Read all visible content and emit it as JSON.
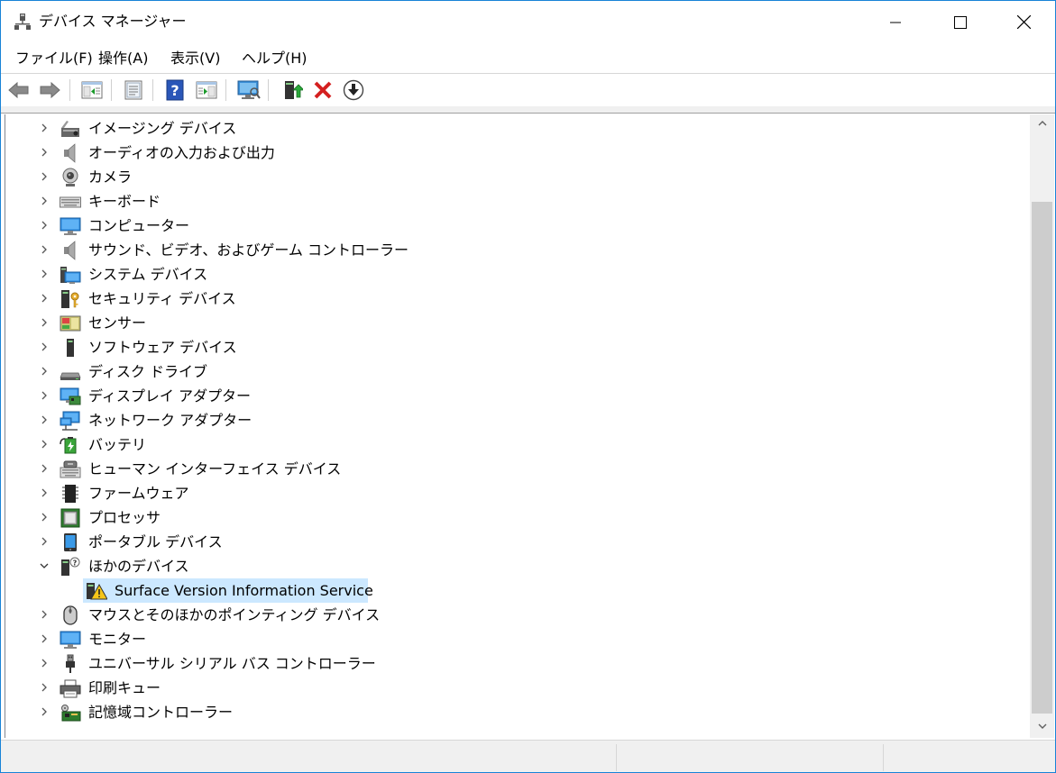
{
  "window": {
    "title": "デバイス マネージャー"
  },
  "menu": [
    {
      "label": "ファイル(F)"
    },
    {
      "label": "操作(A)"
    },
    {
      "label": "表示(V)"
    },
    {
      "label": "ヘルプ(H)"
    }
  ],
  "toolbar": {
    "buttons": [
      "back-arrow",
      "forward-arrow",
      "show-hide-console-tree",
      "properties",
      "help",
      "action-pane",
      "scan-hardware",
      "update-driver",
      "uninstall-device",
      "disable-device"
    ]
  },
  "tree": {
    "items": [
      {
        "label": "イメージング デバイス",
        "icon": "camera-scanner-icon",
        "expanded": false
      },
      {
        "label": "オーディオの入力および出力",
        "icon": "speaker-icon",
        "expanded": false
      },
      {
        "label": "カメラ",
        "icon": "webcam-icon",
        "expanded": false
      },
      {
        "label": "キーボード",
        "icon": "keyboard-icon",
        "expanded": false
      },
      {
        "label": "コンピューター",
        "icon": "monitor-icon",
        "expanded": false
      },
      {
        "label": "サウンド、ビデオ、およびゲーム コントローラー",
        "icon": "speaker-icon",
        "expanded": false
      },
      {
        "label": "システム デバイス",
        "icon": "system-devices-icon",
        "expanded": false
      },
      {
        "label": "セキュリティ デバイス",
        "icon": "security-key-icon",
        "expanded": false
      },
      {
        "label": "センサー",
        "icon": "sensor-icon",
        "expanded": false
      },
      {
        "label": "ソフトウェア デバイス",
        "icon": "software-device-icon",
        "expanded": false
      },
      {
        "label": "ディスク ドライブ",
        "icon": "disk-drive-icon",
        "expanded": false
      },
      {
        "label": "ディスプレイ アダプター",
        "icon": "display-adapter-icon",
        "expanded": false
      },
      {
        "label": "ネットワーク アダプター",
        "icon": "network-adapter-icon",
        "expanded": false
      },
      {
        "label": "バッテリ",
        "icon": "battery-icon",
        "expanded": false
      },
      {
        "label": "ヒューマン インターフェイス デバイス",
        "icon": "hid-icon",
        "expanded": false
      },
      {
        "label": "ファームウェア",
        "icon": "firmware-icon",
        "expanded": false
      },
      {
        "label": "プロセッサ",
        "icon": "processor-icon",
        "expanded": false
      },
      {
        "label": "ポータブル デバイス",
        "icon": "portable-device-icon",
        "expanded": false
      },
      {
        "label": "ほかのデバイス",
        "icon": "unknown-device-icon",
        "expanded": true
      },
      {
        "label": "Surface Version Information Service",
        "icon": "warning-device-icon",
        "child": true,
        "selected": true
      },
      {
        "label": "マウスとそのほかのポインティング デバイス",
        "icon": "mouse-icon",
        "expanded": false
      },
      {
        "label": "モニター",
        "icon": "monitor-icon",
        "expanded": false
      },
      {
        "label": "ユニバーサル シリアル バス コントローラー",
        "icon": "usb-icon",
        "expanded": false
      },
      {
        "label": "印刷キュー",
        "icon": "printer-icon",
        "expanded": false
      },
      {
        "label": "記憶域コントローラー",
        "icon": "storage-controller-icon",
        "expanded": false
      }
    ]
  },
  "colors": {
    "selection": "#cce8ff",
    "border": "#1883d7",
    "scrollbar_thumb": "#cdcdcd"
  }
}
